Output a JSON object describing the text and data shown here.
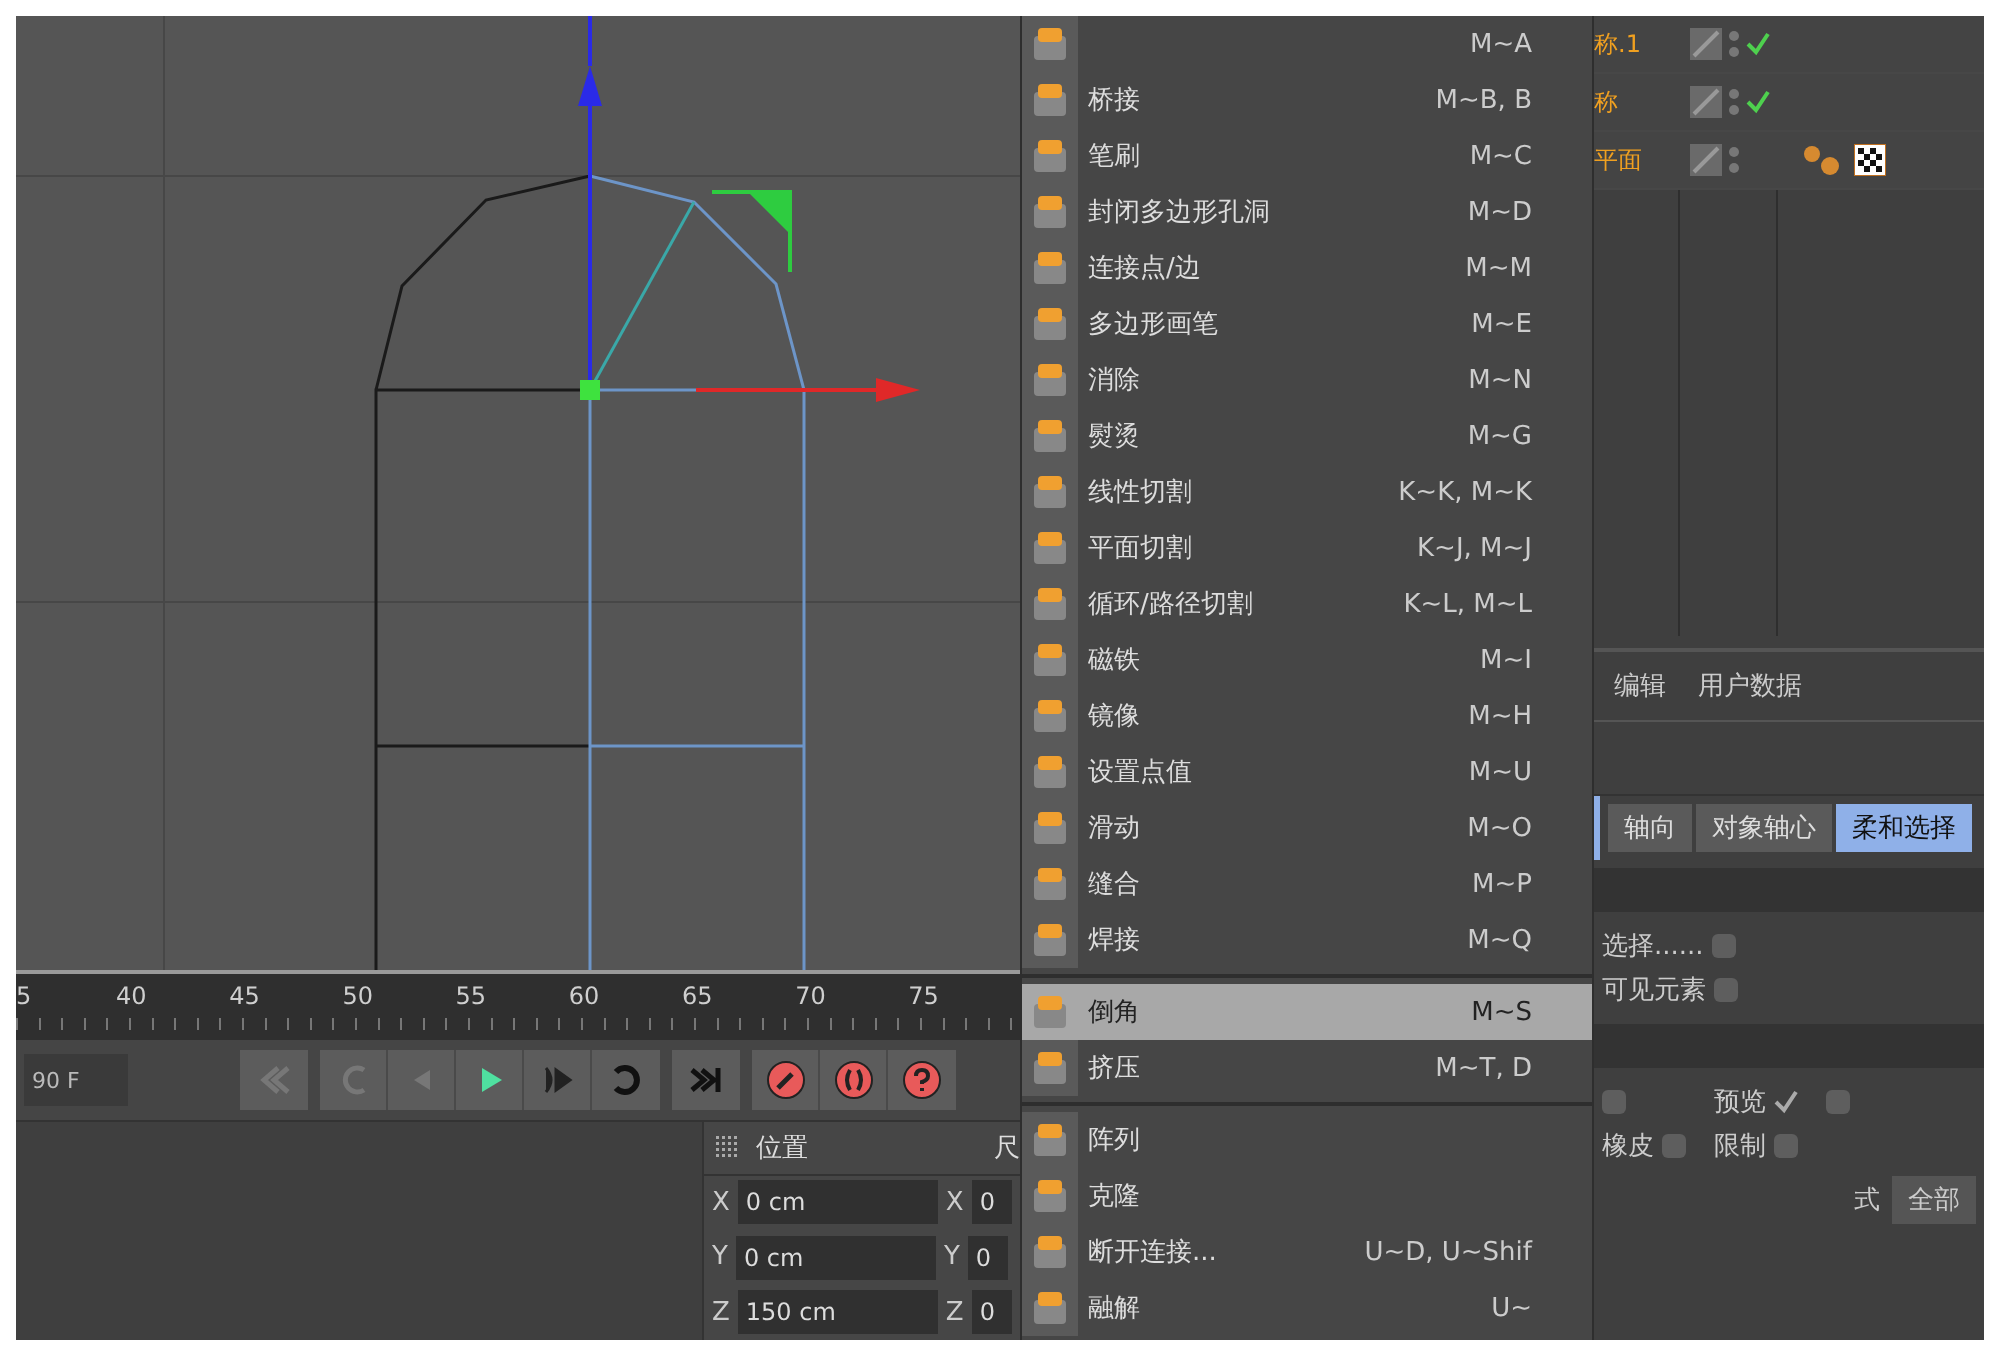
{
  "timeline": {
    "ticks": [
      "5",
      "40",
      "45",
      "50",
      "55",
      "60",
      "65",
      "70",
      "75"
    ],
    "frame_field": "90 F"
  },
  "coordinates": {
    "header": "位置",
    "header_2": "尺",
    "rows": [
      {
        "axis": "X",
        "value": "0 cm",
        "axis_2": "X",
        "value_2": "0"
      },
      {
        "axis": "Y",
        "value": "0 cm",
        "axis_2": "Y",
        "value_2": "0"
      },
      {
        "axis": "Z",
        "value": "150 cm",
        "axis_2": "Z",
        "value_2": "0"
      }
    ]
  },
  "menu": {
    "items": [
      {
        "kind": "item",
        "shortcut": "M~A",
        "selected": false
      },
      {
        "kind": "item",
        "label": "桥接",
        "shortcut": "M~B, B",
        "selected": false
      },
      {
        "kind": "item",
        "label": "笔刷",
        "shortcut": "M~C",
        "selected": false
      },
      {
        "kind": "item",
        "label": "封闭多边形孔洞",
        "shortcut": "M~D",
        "selected": false
      },
      {
        "kind": "item",
        "label": "连接点/边",
        "shortcut": "M~M",
        "selected": false
      },
      {
        "kind": "item",
        "label": "多边形画笔",
        "shortcut": "M~E",
        "selected": false
      },
      {
        "kind": "item",
        "label": "消除",
        "shortcut": "M~N",
        "selected": false
      },
      {
        "kind": "item",
        "label": "熨烫",
        "shortcut": "M~G",
        "selected": false
      },
      {
        "kind": "item",
        "label": "线性切割",
        "shortcut": "K~K, M~K",
        "selected": false
      },
      {
        "kind": "item",
        "label": "平面切割",
        "shortcut": "K~J, M~J",
        "selected": false
      },
      {
        "kind": "item",
        "label": "循环/路径切割",
        "shortcut": "K~L, M~L",
        "selected": false
      },
      {
        "kind": "item",
        "label": "磁铁",
        "shortcut": "M~I",
        "selected": false
      },
      {
        "kind": "item",
        "label": "镜像",
        "shortcut": "M~H",
        "selected": false
      },
      {
        "kind": "item",
        "label": "设置点值",
        "shortcut": "M~U",
        "selected": false
      },
      {
        "kind": "item",
        "label": "滑动",
        "shortcut": "M~O",
        "selected": false
      },
      {
        "kind": "item",
        "label": "缝合",
        "shortcut": "M~P",
        "selected": false
      },
      {
        "kind": "item",
        "label": "焊接",
        "shortcut": "M~Q",
        "selected": false
      },
      {
        "kind": "separator"
      },
      {
        "kind": "item",
        "label": "倒角",
        "shortcut": "M~S",
        "selected": true
      },
      {
        "kind": "item",
        "label": "挤压",
        "shortcut": "M~T, D",
        "selected": false
      },
      {
        "kind": "separator"
      },
      {
        "kind": "item",
        "label": "阵列",
        "selected": false
      },
      {
        "kind": "item",
        "label": "克隆",
        "selected": false
      },
      {
        "kind": "item",
        "label": "断开连接...",
        "shortcut": "U~D, U~Shif",
        "selected": false
      },
      {
        "kind": "item",
        "label": "融解",
        "shortcut": "U~",
        "selected": false
      }
    ]
  },
  "objects": {
    "rows": [
      {
        "name": "称.1",
        "checked": true,
        "tags": false
      },
      {
        "name": "称",
        "checked": true,
        "tags": false
      },
      {
        "name": "平面",
        "checked": false,
        "tags": true
      }
    ]
  },
  "attributes": {
    "tabs": [
      "编辑",
      "用户数据"
    ],
    "modes": [
      {
        "label": "轴向",
        "selected": false
      },
      {
        "label": "对象轴心",
        "selected": false
      },
      {
        "label": "柔和选择",
        "selected": true
      }
    ],
    "options": [
      {
        "label": "选择......",
        "checked": false
      },
      {
        "label": "可见元素",
        "checked": false
      },
      {
        "checked": false
      },
      {
        "label": "预览",
        "checked": true
      },
      {
        "checked": false
      },
      {
        "label": "橡皮",
        "checked": false
      },
      {
        "label": "限制",
        "checked": false
      }
    ],
    "mode_label": "式",
    "mode_value": "全部"
  }
}
